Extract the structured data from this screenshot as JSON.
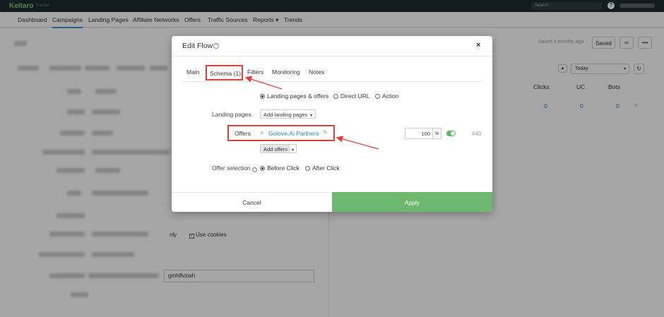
{
  "app": {
    "logo": "Keitaro",
    "logo_sub": "Tracker"
  },
  "topbar": {
    "search_placeholder": "Search",
    "help_icon": "help-icon"
  },
  "nav": {
    "items": [
      "Dashboard",
      "Campaigns",
      "Landing Pages",
      "Affiliate Networks",
      "Offers",
      "Traffic Sources",
      "Reports ▾",
      "Trends"
    ],
    "active": "Campaigns"
  },
  "background": {
    "saved_text": "Saved 4 months ago",
    "saved_button": "Saved",
    "date_select": "Today",
    "columns": [
      "Clicks",
      "UC",
      "Bots"
    ],
    "row_values": [
      "0",
      "0",
      "0"
    ],
    "only_text": "nly",
    "use_cookies_label": "Use cookies",
    "token_value": "gmh8vzwh"
  },
  "modal": {
    "title": "Edit Flow",
    "tabs": [
      "Main",
      "Schema (1)",
      "Filters",
      "Monitoring",
      "Notes"
    ],
    "active_tab": "Schema (1)",
    "schema_options": [
      "Landing pages & offers",
      "Direct URL",
      "Action"
    ],
    "schema_selected": "Landing pages & offers",
    "landing_pages_label": "Landing pages",
    "add_landing_pages": "Add landing pages",
    "offers_label": "Offers",
    "offer_name": "Golove.Ai Parthers",
    "offer_weight": "100",
    "percent_sign": "%",
    "flow_id": "#40",
    "add_offers": "Add offers",
    "offer_selection_label": "Offer selection",
    "offer_selection_options": [
      "Before Click",
      "After Click"
    ],
    "offer_selection_selected": "Before Click",
    "cancel": "Cancel",
    "apply": "Apply"
  },
  "colors": {
    "accent_green": "#6cb86e",
    "highlight_red": "#e0403a",
    "link_blue": "#2f7fcf"
  }
}
